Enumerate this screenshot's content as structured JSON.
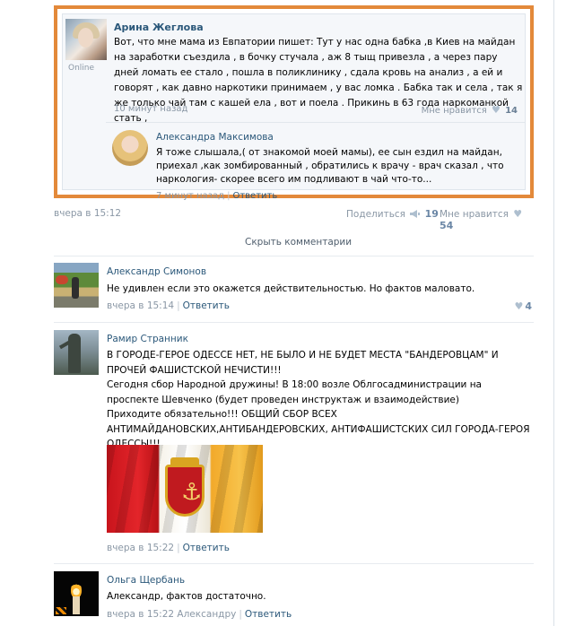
{
  "repost": {
    "author": {
      "name": "Арина Жеглова",
      "status": "Online"
    },
    "text": "Вот, что мне мама из Евпатории пишет: Тут у нас одна бабка ,в Киев на майдан на заработки съездила , в бочку стучала , аж 8 тыщ привезла , а через пару дней ломать ее стало , пошла в поликлинику , сдала кровь на анализ , а ей и говорят , как давно наркотики принимаем , у вас ломка . Бабка так и села , так я же только чай там с кашей ела , вот и поела . Прикинь в 63 года наркоманкой стать ,",
    "time": "10 минут назад",
    "like_label": "Мне нравится",
    "like_count": "14",
    "reply": {
      "author": "Александра Максимова",
      "text": "Я тоже слышала,( от знакомой моей мамы), ее сын ездил на майдан, приехал ,как зомбированный , обратились к врачу - врач сказал , что наркология- скорее всего им подливают в чай что-то...",
      "time": "7 минут назад",
      "reply_label": "Ответить"
    }
  },
  "post": {
    "date": "вчера в 15:12",
    "share_label": "Поделиться",
    "share_count": "19",
    "like_label": "Мне нравится",
    "like_count": "54"
  },
  "hide_comments_label": "Скрыть комментарии",
  "comments": [
    {
      "author": "Александр Симонов",
      "text": "Не удивлен если это окажется действительностью. Но фактов маловато.",
      "date": "вчера в 15:14",
      "reply_label": "Ответить",
      "like_count": "4"
    },
    {
      "author": "Рамир Странник",
      "lines": [
        "В ГОРОДЕ-ГЕРОЕ ОДЕССЕ НЕТ, НЕ БЫЛО И НЕ БУДЕТ МЕСТА \"БАНДЕРОВЦАМ\" И ПРОЧЕЙ ФАШИСТСКОЙ НЕЧИСТИ!!!",
        "Сегодня сбор Народной дружины! В 18:00 возле Облгосадминистрации на проспекте Шевченко (будет проведен инструктаж и взаимодействие)",
        "Приходите обязательно!!! ОБЩИЙ СБОР ВСЕХ АНТИМАЙДАНОВСКИХ,АНТИБАНДЕРОВСКИХ, АНТИФАШИСТСКИХ СИЛ ГОРОДА-ГЕРОЯ ОДЕССЫ!!!"
      ],
      "date": "вчера в 15:22",
      "reply_label": "Ответить"
    },
    {
      "author": "Ольга Щербань",
      "text": "Александр, фактов достаточно.",
      "date": "вчера в 15:22 Александру",
      "reply_label": "Ответить"
    }
  ],
  "colors": {
    "frame": "#e3893a",
    "link": "#2b587a",
    "muted": "#8a97a5"
  },
  "icons": [
    "heart-icon",
    "megaphone-icon",
    "user-avatar"
  ]
}
